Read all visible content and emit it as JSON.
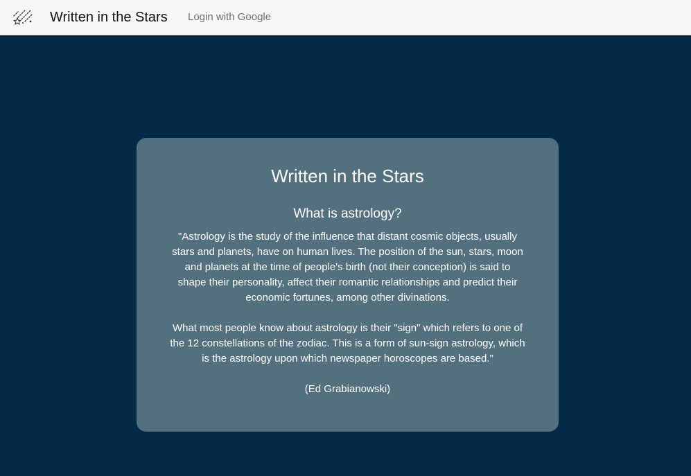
{
  "navbar": {
    "brand_icon": "shooting-stars-icon",
    "brand_name": "Written in the Stars",
    "login_label": "Login with Google"
  },
  "card": {
    "title": "Written in the Stars",
    "subtitle": "What is astrology?",
    "paragraph_1": "\"Astrology is the study of the influence that distant cosmic objects, usually stars and planets, have on human lives. The position of the sun, stars, moon and planets at the time of people's birth (not their conception) is said to shape their personality, affect their romantic relationships and predict their economic fortunes, among other divinations.",
    "paragraph_2": "What most people know about astrology is their \"sign\" which refers to one of the 12 constellations of the zodiac. This is a form of sun-sign astrology, which is the astrology upon which newspaper horoscopes are based.\"",
    "author": "(Ed Grabianowski)"
  },
  "colors": {
    "navbar_bg": "#f6f7f9",
    "page_bg": "#052a47",
    "card_bg": "#53707f",
    "text_light": "#ffffff",
    "link_muted": "#6e6e6e"
  }
}
